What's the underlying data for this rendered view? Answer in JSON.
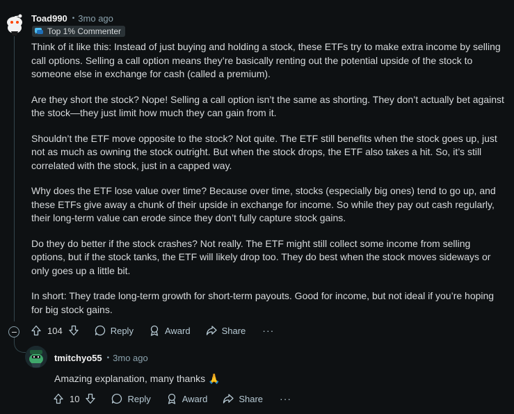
{
  "comment": {
    "author": "Toad990",
    "separator": "•",
    "time": "3mo ago",
    "flair": "Top 1% Commenter",
    "paragraphs": [
      "Think of it like this: Instead of just buying and holding a stock, these ETFs try to make extra income by selling call options. Selling a call option means they’re basically renting out the potential upside of the stock to someone else in exchange for cash (called a premium).",
      "Are they short the stock? Nope! Selling a call option isn’t the same as shorting. They don’t actually bet against the stock—they just limit how much they can gain from it.",
      "Shouldn’t the ETF move opposite to the stock? Not quite. The ETF still benefits when the stock goes up, just not as much as owning the stock outright. But when the stock drops, the ETF also takes a hit. So, it’s still correlated with the stock, just in a capped way.",
      "Why does the ETF lose value over time? Because over time, stocks (especially big ones) tend to go up, and these ETFs give away a chunk of their upside in exchange for income. So while they pay out cash regularly, their long-term value can erode since they don’t fully capture stock gains.",
      "Do they do better if the stock crashes? Not really. The ETF might still collect some income from selling options, but if the stock tanks, the ETF will likely drop too. They do best when the stock moves sideways or only goes up a little bit.",
      "In short: They trade long-term growth for short-term payouts. Good for income, but not ideal if you’re hoping for big stock gains."
    ],
    "votes": "104",
    "actions": {
      "reply": "Reply",
      "award": "Award",
      "share": "Share",
      "more": "···"
    }
  },
  "reply": {
    "author": "tmitchyo55",
    "separator": "•",
    "time": "3mo ago",
    "body": "Amazing explanation, many thanks 🙏",
    "votes": "10",
    "actions": {
      "reply": "Reply",
      "award": "Award",
      "share": "Share",
      "more": "···"
    }
  },
  "colors": {
    "background": "#0e1113",
    "text": "#d7dadc",
    "meta": "#8ba2ad",
    "flair_bg": "#2a3236"
  }
}
